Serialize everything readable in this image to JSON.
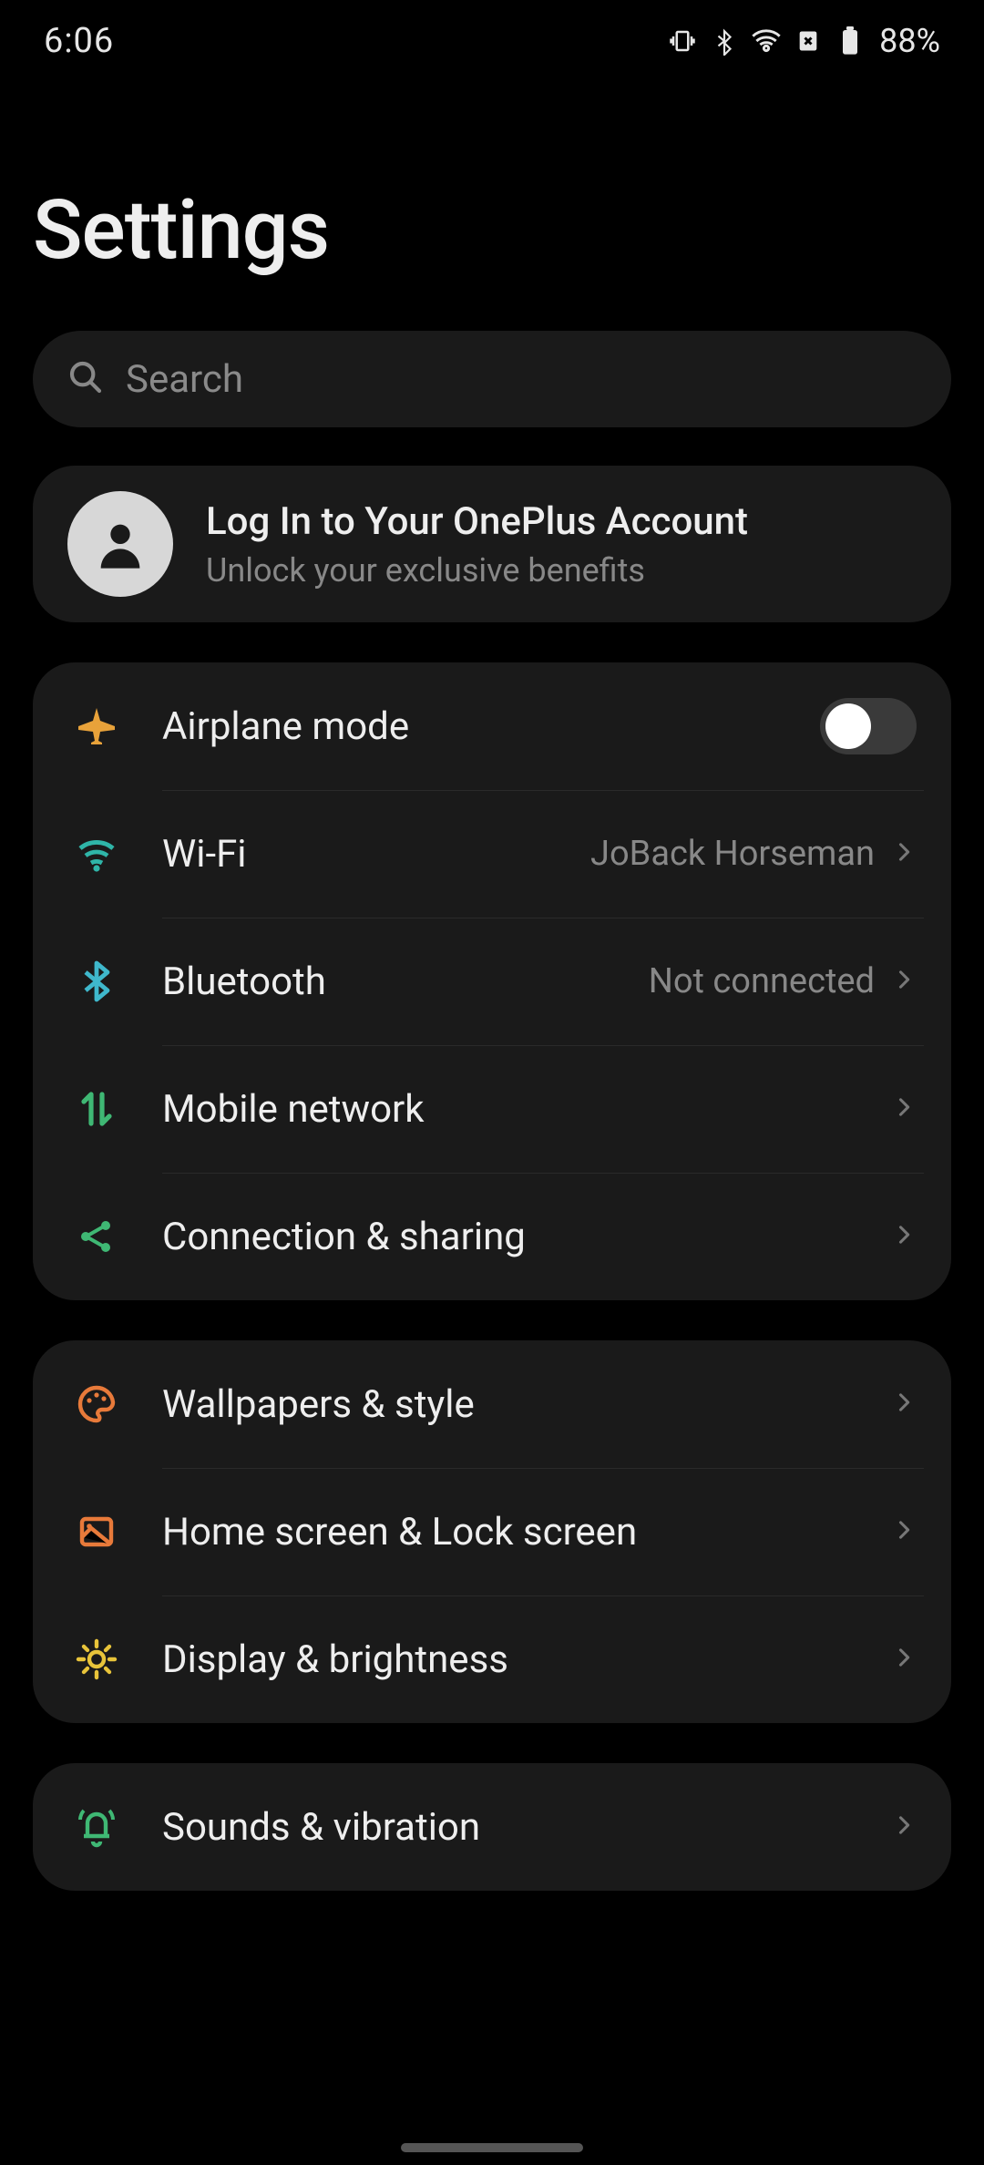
{
  "statusbar": {
    "time": "6:06",
    "battery": "88%"
  },
  "title": "Settings",
  "search": {
    "placeholder": "Search"
  },
  "account": {
    "title": "Log In to Your OnePlus Account",
    "subtitle": "Unlock your exclusive benefits"
  },
  "groups": [
    {
      "rows": [
        {
          "id": "airplane",
          "icon": "airplane",
          "color": "#e8a23a",
          "label": "Airplane mode",
          "toggle": false
        },
        {
          "id": "wifi",
          "icon": "wifi",
          "color": "#2fb5a8",
          "label": "Wi-Fi",
          "value": "JoBack Horseman",
          "chevron": true
        },
        {
          "id": "bluetooth",
          "icon": "bluetooth",
          "color": "#3fb8cc",
          "label": "Bluetooth",
          "value": "Not connected",
          "chevron": true
        },
        {
          "id": "mobile",
          "icon": "mobile-data",
          "color": "#3fb874",
          "label": "Mobile network",
          "chevron": true
        },
        {
          "id": "connection",
          "icon": "share",
          "color": "#3fb874",
          "label": "Connection & sharing",
          "chevron": true
        }
      ]
    },
    {
      "rows": [
        {
          "id": "wallpapers",
          "icon": "palette",
          "color": "#e87a3a",
          "label": "Wallpapers & style",
          "chevron": true
        },
        {
          "id": "homescreen",
          "icon": "home-lock",
          "color": "#e87a3a",
          "label": "Home screen & Lock screen",
          "chevron": true
        },
        {
          "id": "display",
          "icon": "brightness",
          "color": "#e8c43a",
          "label": "Display & brightness",
          "chevron": true
        }
      ]
    },
    {
      "rows": [
        {
          "id": "sounds",
          "icon": "bell",
          "color": "#3fb874",
          "label": "Sounds & vibration",
          "chevron": true
        }
      ]
    }
  ]
}
